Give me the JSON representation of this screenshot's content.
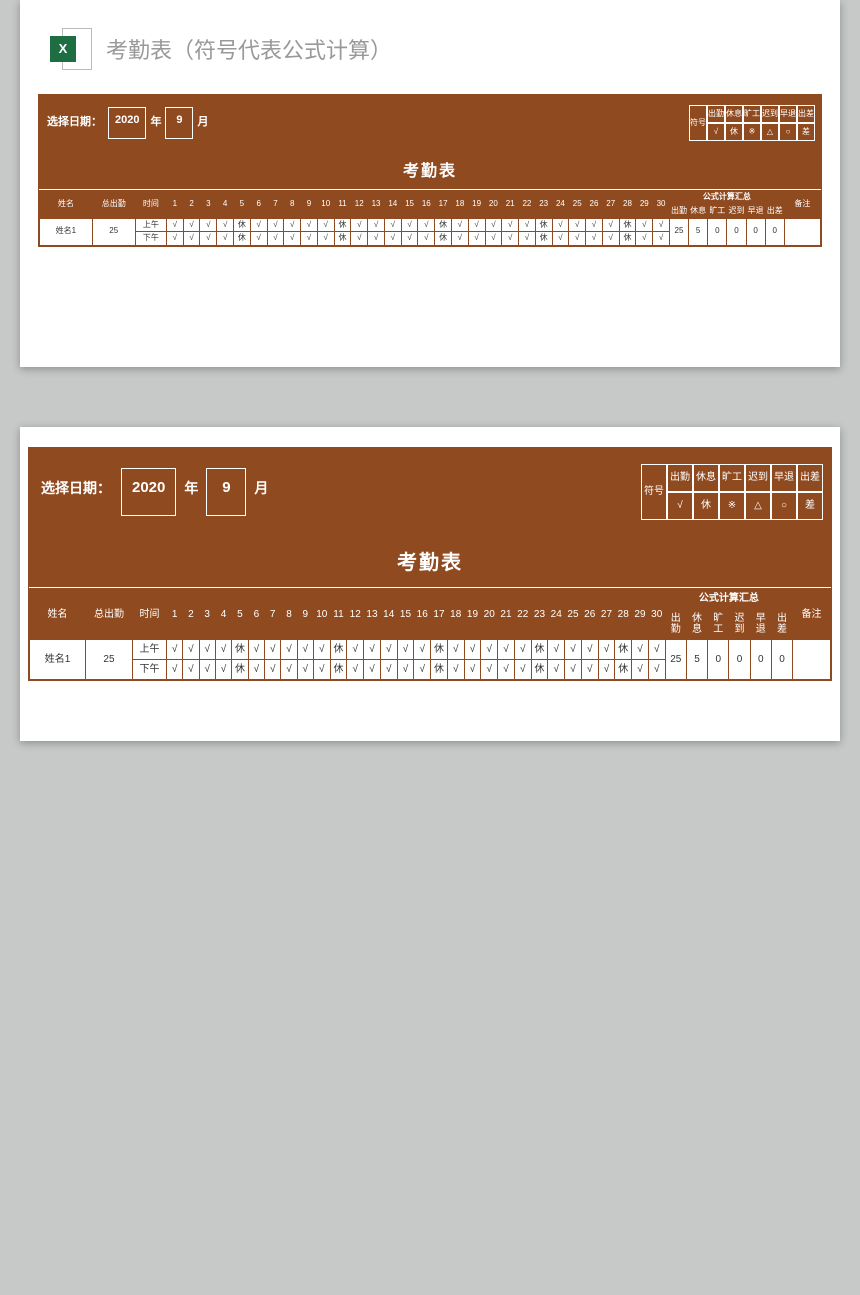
{
  "doc_title": "考勤表（符号代表公式计算）",
  "header": {
    "select_label": "选择日期：",
    "year": "2020",
    "year_unit": "年",
    "month": "9",
    "month_unit": "月"
  },
  "legend": {
    "symbol_label": "符号",
    "cols": [
      {
        "head": "出勤",
        "val": "√"
      },
      {
        "head": "休息",
        "val": "休"
      },
      {
        "head": "旷工",
        "val": "※"
      },
      {
        "head": "迟到",
        "val": "△"
      },
      {
        "head": "早退",
        "val": "○"
      },
      {
        "head": "出差",
        "val": "差"
      }
    ]
  },
  "sheet_title": "考勤表",
  "columns": {
    "name": "姓名",
    "total": "总出勤",
    "period": "时间",
    "days": [
      "1",
      "2",
      "3",
      "4",
      "5",
      "6",
      "7",
      "8",
      "9",
      "10",
      "11",
      "12",
      "13",
      "14",
      "15",
      "16",
      "17",
      "18",
      "19",
      "20",
      "21",
      "22",
      "23",
      "24",
      "25",
      "26",
      "27",
      "28",
      "29",
      "30"
    ],
    "calc_head": "公式计算汇总",
    "calc_cols": [
      "出勤",
      "休息",
      "旷工",
      "迟到",
      "早退",
      "出差"
    ],
    "note": "备注"
  },
  "periods": {
    "am": "上午",
    "pm": "下午"
  },
  "rows": [
    {
      "name": "姓名1",
      "total": "25",
      "am": [
        "√",
        "√",
        "√",
        "√",
        "休",
        "√",
        "√",
        "√",
        "√",
        "√",
        "休",
        "√",
        "√",
        "√",
        "√",
        "√",
        "休",
        "√",
        "√",
        "√",
        "√",
        "√",
        "休",
        "√",
        "√",
        "√",
        "√",
        "休",
        "√",
        "√"
      ],
      "pm": [
        "√",
        "√",
        "√",
        "√",
        "休",
        "√",
        "√",
        "√",
        "√",
        "√",
        "休",
        "√",
        "√",
        "√",
        "√",
        "√",
        "休",
        "√",
        "√",
        "√",
        "√",
        "√",
        "休",
        "√",
        "√",
        "√",
        "√",
        "休",
        "√",
        "√"
      ],
      "calc": [
        "25",
        "5",
        "0",
        "0",
        "0",
        "0"
      ],
      "note": ""
    }
  ]
}
